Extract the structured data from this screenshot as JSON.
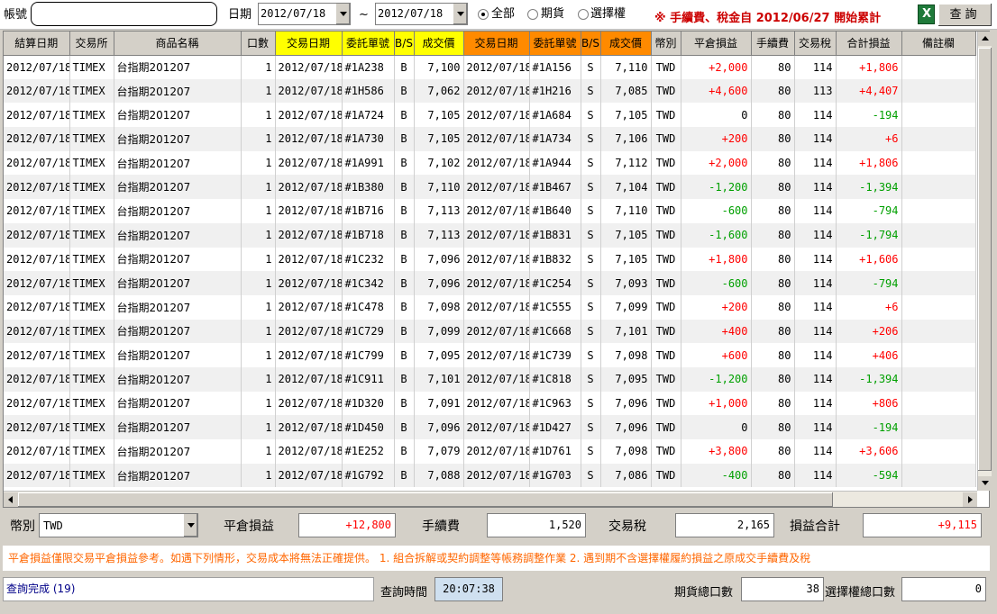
{
  "toolbar": {
    "account_label": "帳號",
    "account_value": "",
    "date_label": "日期",
    "date_from": "2012/07/18",
    "tilde": "~",
    "date_to": "2012/07/18",
    "radio_all": "全部",
    "radio_futures": "期貨",
    "radio_options": "選擇權",
    "notice": "※ 手續費、稅金自 2012/06/27 開始累計",
    "query_label": "查詢"
  },
  "columns": [
    "結算日期",
    "交易所",
    "商品名稱",
    "口數",
    "交易日期",
    "委託單號",
    "B/S",
    "成交價",
    "交易日期",
    "委託單號",
    "B/S",
    "成交價",
    "幣別",
    "平倉損益",
    "手續費",
    "交易稅",
    "合計損益",
    "備註欄"
  ],
  "rows": [
    [
      "2012/07/18",
      "TIMEX",
      "台指期201207",
      "1",
      "2012/07/18",
      "#1A238",
      "B",
      "7,100",
      "2012/07/18",
      "#1A156",
      "S",
      "7,110",
      "TWD",
      "+2,000",
      "80",
      "114",
      "+1,806",
      ""
    ],
    [
      "2012/07/18",
      "TIMEX",
      "台指期201207",
      "1",
      "2012/07/18",
      "#1H586",
      "B",
      "7,062",
      "2012/07/18",
      "#1H216",
      "S",
      "7,085",
      "TWD",
      "+4,600",
      "80",
      "113",
      "+4,407",
      ""
    ],
    [
      "2012/07/18",
      "TIMEX",
      "台指期201207",
      "1",
      "2012/07/18",
      "#1A724",
      "B",
      "7,105",
      "2012/07/18",
      "#1A684",
      "S",
      "7,105",
      "TWD",
      "0",
      "80",
      "114",
      "-194",
      ""
    ],
    [
      "2012/07/18",
      "TIMEX",
      "台指期201207",
      "1",
      "2012/07/18",
      "#1A730",
      "B",
      "7,105",
      "2012/07/18",
      "#1A734",
      "S",
      "7,106",
      "TWD",
      "+200",
      "80",
      "114",
      "+6",
      ""
    ],
    [
      "2012/07/18",
      "TIMEX",
      "台指期201207",
      "1",
      "2012/07/18",
      "#1A991",
      "B",
      "7,102",
      "2012/07/18",
      "#1A944",
      "S",
      "7,112",
      "TWD",
      "+2,000",
      "80",
      "114",
      "+1,806",
      ""
    ],
    [
      "2012/07/18",
      "TIMEX",
      "台指期201207",
      "1",
      "2012/07/18",
      "#1B380",
      "B",
      "7,110",
      "2012/07/18",
      "#1B467",
      "S",
      "7,104",
      "TWD",
      "-1,200",
      "80",
      "114",
      "-1,394",
      ""
    ],
    [
      "2012/07/18",
      "TIMEX",
      "台指期201207",
      "1",
      "2012/07/18",
      "#1B716",
      "B",
      "7,113",
      "2012/07/18",
      "#1B640",
      "S",
      "7,110",
      "TWD",
      "-600",
      "80",
      "114",
      "-794",
      ""
    ],
    [
      "2012/07/18",
      "TIMEX",
      "台指期201207",
      "1",
      "2012/07/18",
      "#1B718",
      "B",
      "7,113",
      "2012/07/18",
      "#1B831",
      "S",
      "7,105",
      "TWD",
      "-1,600",
      "80",
      "114",
      "-1,794",
      ""
    ],
    [
      "2012/07/18",
      "TIMEX",
      "台指期201207",
      "1",
      "2012/07/18",
      "#1C232",
      "B",
      "7,096",
      "2012/07/18",
      "#1B832",
      "S",
      "7,105",
      "TWD",
      "+1,800",
      "80",
      "114",
      "+1,606",
      ""
    ],
    [
      "2012/07/18",
      "TIMEX",
      "台指期201207",
      "1",
      "2012/07/18",
      "#1C342",
      "B",
      "7,096",
      "2012/07/18",
      "#1C254",
      "S",
      "7,093",
      "TWD",
      "-600",
      "80",
      "114",
      "-794",
      ""
    ],
    [
      "2012/07/18",
      "TIMEX",
      "台指期201207",
      "1",
      "2012/07/18",
      "#1C478",
      "B",
      "7,098",
      "2012/07/18",
      "#1C555",
      "S",
      "7,099",
      "TWD",
      "+200",
      "80",
      "114",
      "+6",
      ""
    ],
    [
      "2012/07/18",
      "TIMEX",
      "台指期201207",
      "1",
      "2012/07/18",
      "#1C729",
      "B",
      "7,099",
      "2012/07/18",
      "#1C668",
      "S",
      "7,101",
      "TWD",
      "+400",
      "80",
      "114",
      "+206",
      ""
    ],
    [
      "2012/07/18",
      "TIMEX",
      "台指期201207",
      "1",
      "2012/07/18",
      "#1C799",
      "B",
      "7,095",
      "2012/07/18",
      "#1C739",
      "S",
      "7,098",
      "TWD",
      "+600",
      "80",
      "114",
      "+406",
      ""
    ],
    [
      "2012/07/18",
      "TIMEX",
      "台指期201207",
      "1",
      "2012/07/18",
      "#1C911",
      "B",
      "7,101",
      "2012/07/18",
      "#1C818",
      "S",
      "7,095",
      "TWD",
      "-1,200",
      "80",
      "114",
      "-1,394",
      ""
    ],
    [
      "2012/07/18",
      "TIMEX",
      "台指期201207",
      "1",
      "2012/07/18",
      "#1D320",
      "B",
      "7,091",
      "2012/07/18",
      "#1C963",
      "S",
      "7,096",
      "TWD",
      "+1,000",
      "80",
      "114",
      "+806",
      ""
    ],
    [
      "2012/07/18",
      "TIMEX",
      "台指期201207",
      "1",
      "2012/07/18",
      "#1D450",
      "B",
      "7,096",
      "2012/07/18",
      "#1D427",
      "S",
      "7,096",
      "TWD",
      "0",
      "80",
      "114",
      "-194",
      ""
    ],
    [
      "2012/07/18",
      "TIMEX",
      "台指期201207",
      "1",
      "2012/07/18",
      "#1E252",
      "B",
      "7,079",
      "2012/07/18",
      "#1D761",
      "S",
      "7,098",
      "TWD",
      "+3,800",
      "80",
      "114",
      "+3,606",
      ""
    ],
    [
      "2012/07/18",
      "TIMEX",
      "台指期201207",
      "1",
      "2012/07/18",
      "#1G792",
      "B",
      "7,088",
      "2012/07/18",
      "#1G703",
      "S",
      "7,086",
      "TWD",
      "-400",
      "80",
      "114",
      "-594",
      ""
    ]
  ],
  "summary": {
    "currency_label": "幣別",
    "currency_value": "TWD",
    "pnl_label": "平倉損益",
    "pnl_value": "+12,800",
    "fee_label": "手續費",
    "fee_value": "1,520",
    "tax_label": "交易稅",
    "tax_value": "2,165",
    "total_label": "損益合計",
    "total_value": "+9,115"
  },
  "info_text": "平倉損益僅限交易平倉損益參考。如遇下列情形，交易成本將無法正確提供。 1. 組合拆解或契約調整等帳務調整作業 2. 遇到期不含選擇權履約損益之原成交手續費及稅",
  "status": {
    "message": "查詢完成 (19)",
    "query_time_label": "查詢時間",
    "query_time": "20:07:38",
    "futures_lots_label": "期貨總口數",
    "futures_lots": "38",
    "options_lots_label": "選擇權總口數",
    "options_lots": "0"
  },
  "colors": {
    "header_yellow": "#ffff00",
    "header_orange": "#ff8a00",
    "profit": "#ff0000",
    "loss": "#00a000",
    "notice": "#cc0000",
    "info": "#ff6600"
  }
}
